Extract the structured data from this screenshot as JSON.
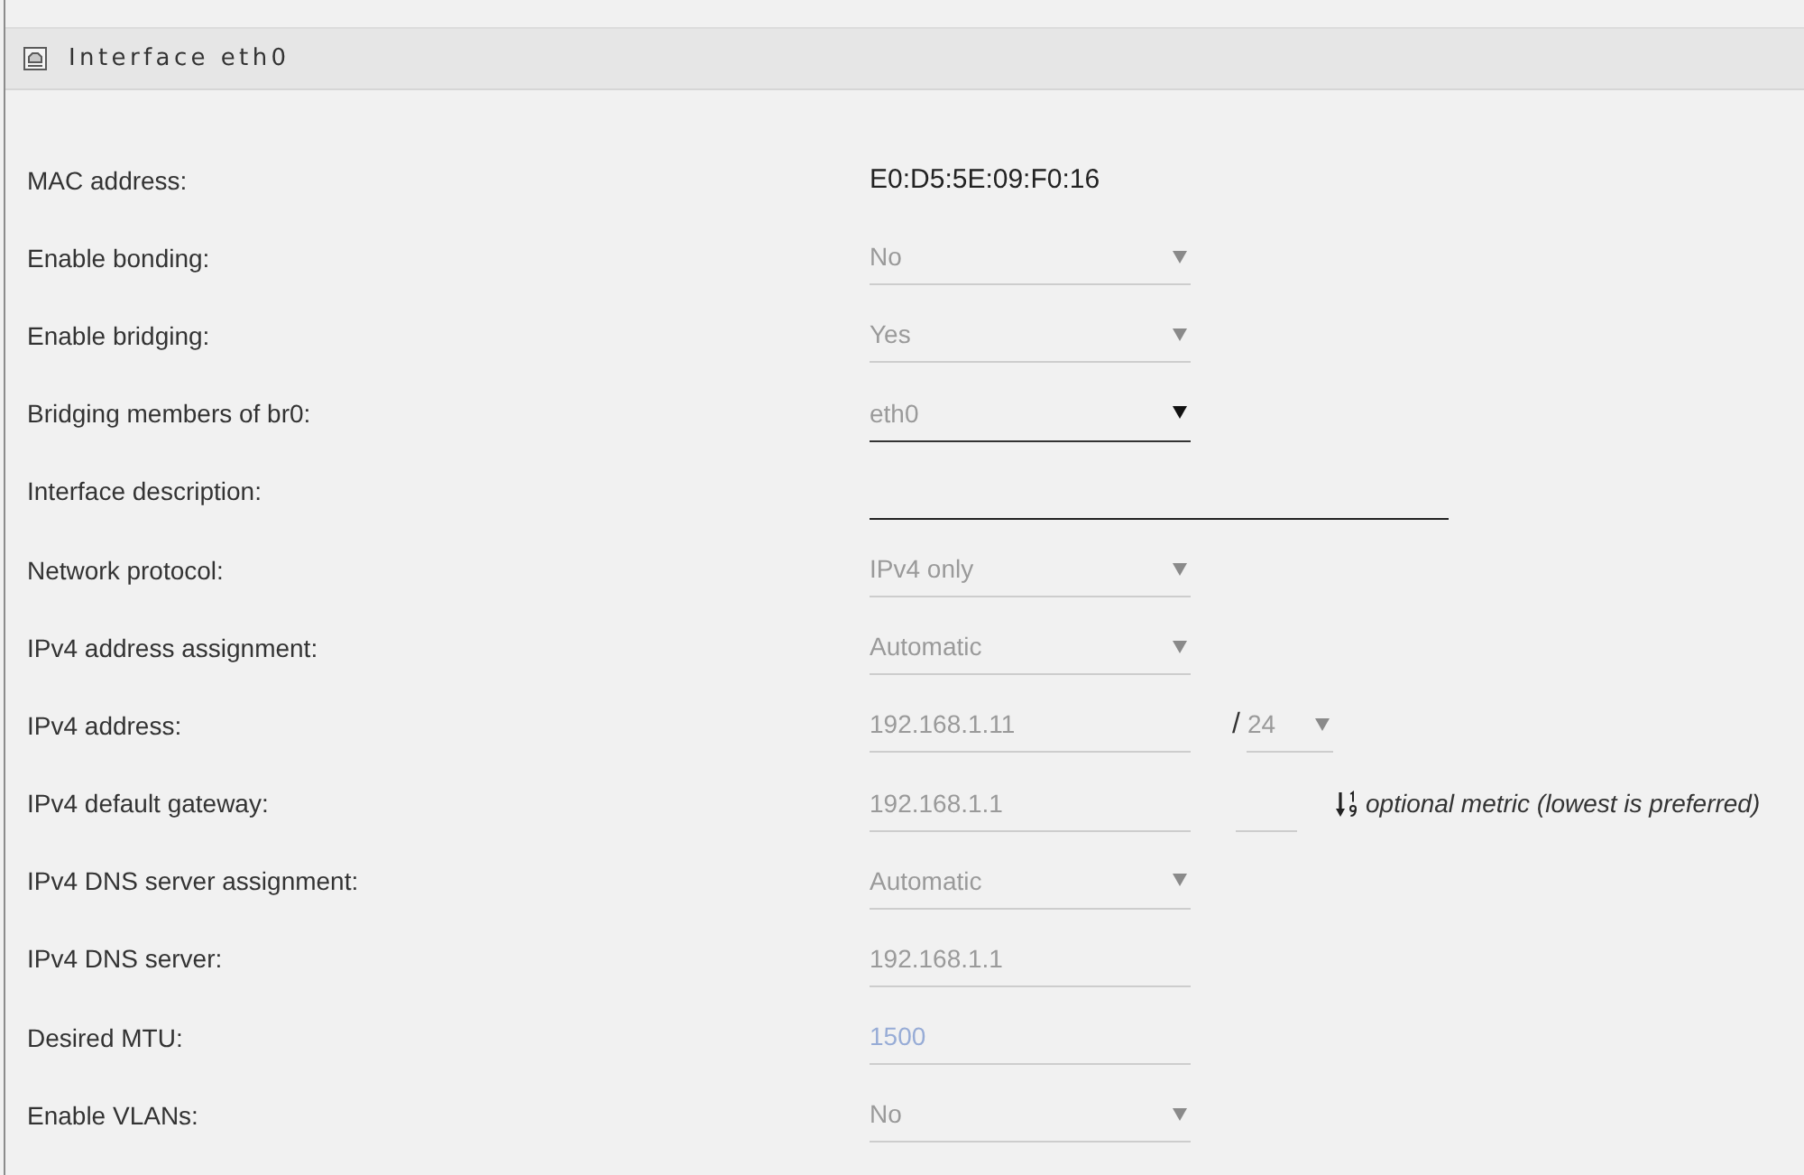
{
  "panel": {
    "title": "Interface eth0"
  },
  "rows": [
    {
      "kind": "text",
      "label": "MAC address:",
      "value": "E0:D5:5E:09:F0:16"
    },
    {
      "kind": "select",
      "label": "Enable bonding:",
      "value": "No",
      "disabled": true
    },
    {
      "kind": "select",
      "label": "Enable bridging:",
      "value": "Yes",
      "disabled": true
    },
    {
      "kind": "select",
      "label": "Bridging members of br0:",
      "value": "eth0",
      "disabled": false
    },
    {
      "kind": "textline",
      "label": "Interface description:",
      "disabled": false
    },
    {
      "kind": "select",
      "label": "Network protocol:",
      "value": "IPv4 only",
      "disabled": true
    },
    {
      "kind": "select",
      "label": "IPv4 address assignment:",
      "value": "Automatic",
      "disabled": true
    },
    {
      "kind": "input",
      "label": "IPv4 address:",
      "value": "192.168.1.11",
      "disabled": true,
      "separator": "/",
      "prefix": {
        "value": "24",
        "disabled": true
      }
    },
    {
      "kind": "input",
      "label": "IPv4 default gateway:",
      "value": "192.168.1.1",
      "disabled": true,
      "metric": {
        "disabled": true
      },
      "hint": "optional metric (lowest is preferred)"
    },
    {
      "kind": "select",
      "label": "IPv4 DNS server assignment:",
      "value": "Automatic",
      "disabled": true
    },
    {
      "kind": "input",
      "label": "IPv4 DNS server:",
      "value": "192.168.1.1",
      "disabled": true
    },
    {
      "kind": "input",
      "label": "Desired MTU:",
      "placeholder": "1500",
      "disabled": true
    },
    {
      "kind": "select",
      "label": "Enable VLANs:",
      "value": "No",
      "disabled": true
    }
  ]
}
